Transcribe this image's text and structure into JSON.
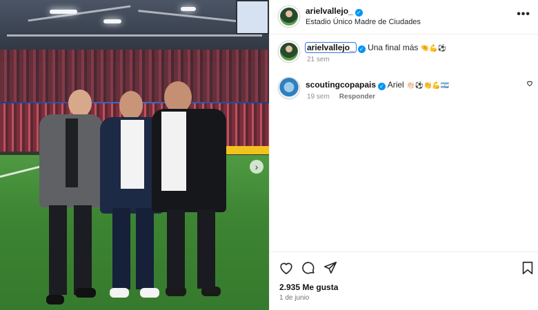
{
  "post": {
    "username": "arielvallejo_",
    "location": "Estadio Único Madre de Ciudades",
    "more_label": "•••"
  },
  "comments": [
    {
      "username": "arielvallejo_",
      "text": "Una final más",
      "emoji": "🤏💪⚽",
      "time": "21 sem",
      "reply_label": ""
    },
    {
      "username": "scoutingcopapais",
      "text": "Ariel",
      "emoji": "👏🏻⚽👏💪🇦🇷",
      "time": "19 sem",
      "reply_label": "Responder"
    }
  ],
  "footer": {
    "likes": "2.935 Me gusta",
    "date": "1 de junio"
  },
  "icons": {
    "verified": "verified-badge",
    "like": "heart-icon",
    "comment": "comment-icon",
    "share": "share-icon",
    "save": "bookmark-icon",
    "next": "chevron-right-icon"
  },
  "colors": {
    "accent": "#0095f6",
    "muted": "#8e8e8e"
  },
  "carousel_next": "›"
}
